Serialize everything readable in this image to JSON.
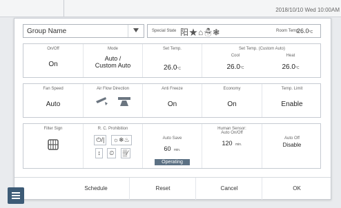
{
  "datetime": "2018/10/10 Wed 10:00AM",
  "header": {
    "group_name": "Group Name",
    "special_state_label": "Special State",
    "special_state_icons": "阳★⌂☃❃",
    "room_temp_label": "Room Temp.",
    "room_temp_value": "26.0",
    "room_temp_unit": "°C"
  },
  "row1": {
    "onoff_label": "On/Off",
    "onoff_value": "On",
    "mode_label": "Mode",
    "mode_value": "Auto /\nCustom Auto",
    "settemp_label": "Set Temp.",
    "settemp_value": "26.0",
    "settemp_custom_label": "Set Temp. (Custom Auto)",
    "cool_label": "Cool",
    "cool_value": "26.0",
    "heat_label": "Heat",
    "heat_value": "26.0",
    "unit": "°C"
  },
  "row2": {
    "fan_speed_label": "Fan Speed",
    "fan_speed_value": "Auto",
    "airflow_label": "Air Flow Direction",
    "anti_freeze_label": "Anti Freeze",
    "anti_freeze_value": "On",
    "economy_label": "Economy",
    "economy_value": "On",
    "temp_limit_label": "Temp. Limit",
    "temp_limit_value": "Enable"
  },
  "row3": {
    "filter_sign_label": "Filter Sign",
    "rc_prohibition_label": "R. C. Prohibition",
    "rc_icons_top": [
      "⏻/|",
      "☼❄♨"
    ],
    "rc_icons_bottom": [
      "↕",
      "⏲",
      "▒⁄"
    ],
    "auto_save_label": "Auto Save",
    "auto_save_value": "60",
    "auto_save_unit": "min.",
    "operating_label": "Operating",
    "human_sensor_label": "Human Sensor:",
    "human_sensor_sub": "Auto On/Off",
    "human_sensor_value": "120",
    "human_sensor_unit": "min.",
    "auto_off_label": "Auto Off",
    "auto_off_value": "Disable"
  },
  "footer": {
    "schedule": "Schedule",
    "reset": "Reset",
    "cancel": "Cancel",
    "ok": "OK"
  }
}
